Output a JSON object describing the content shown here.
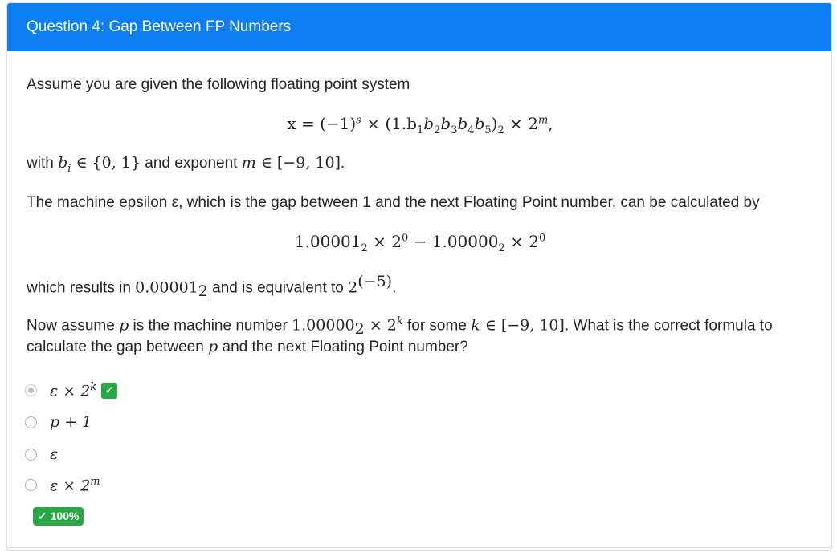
{
  "header": {
    "title": "Question 4: Gap Between FP Numbers"
  },
  "intro": {
    "text": "Assume you are given the following floating point system"
  },
  "formula1": {
    "lhs": "x = (−1)",
    "s": "s",
    "mid": " × (1.b",
    "b1": "1",
    "b2": "2",
    "b3": "3",
    "b4": "4",
    "b5": "5",
    "base": "2",
    "times": " × 2",
    "m": "m",
    "end": ","
  },
  "line2": {
    "pre": "with ",
    "bi": "b",
    "i": "i",
    "set": " ∈ {0, 1}",
    "mid": " and exponent ",
    "mvar": "m",
    "range": " ∈ [−9, 10]",
    "end": "."
  },
  "line3": {
    "text": "The machine epsilon ε, which is the gap between 1 and the next Floating Point number, can be calculated by"
  },
  "formula2": {
    "a": "1.00001",
    "a_sub": "2",
    "mid": " × 2",
    "e1": "0",
    "minus": " − 1.00000",
    "b_sub": "2",
    "mid2": " × 2",
    "e2": "0"
  },
  "line4": {
    "pre": "which results in ",
    "val": "0.00001",
    "val_sub": "2",
    "mid": " and is equivalent to ",
    "pow": "2",
    "exp": "(−5)",
    "end": "."
  },
  "line5": {
    "pre": "Now assume ",
    "p": "p",
    "mid": " is the machine number ",
    "num": "1.00000",
    "num_sub": "2",
    "times": " × 2",
    "k": "k",
    "mid2": " for some ",
    "kvar": "k",
    "range": " ∈ [−9, 10]",
    "end": ". What is the correct formula to"
  },
  "line6": {
    "text": "calculate the gap between ",
    "p": "p",
    "end": " and the next Floating Point number?"
  },
  "options": [
    {
      "pre": "ε × 2",
      "sup": "k",
      "selected": true,
      "correct": true
    },
    {
      "pre": "p + 1",
      "sup": ""
    },
    {
      "pre": "ε",
      "sup": ""
    },
    {
      "pre": "ε × 2",
      "sup": "m"
    }
  ],
  "score": {
    "label": "✓ 100%"
  },
  "colors": {
    "header": "#0d7ff3",
    "success": "#28a745"
  },
  "icons": {
    "correct": "check-icon"
  }
}
